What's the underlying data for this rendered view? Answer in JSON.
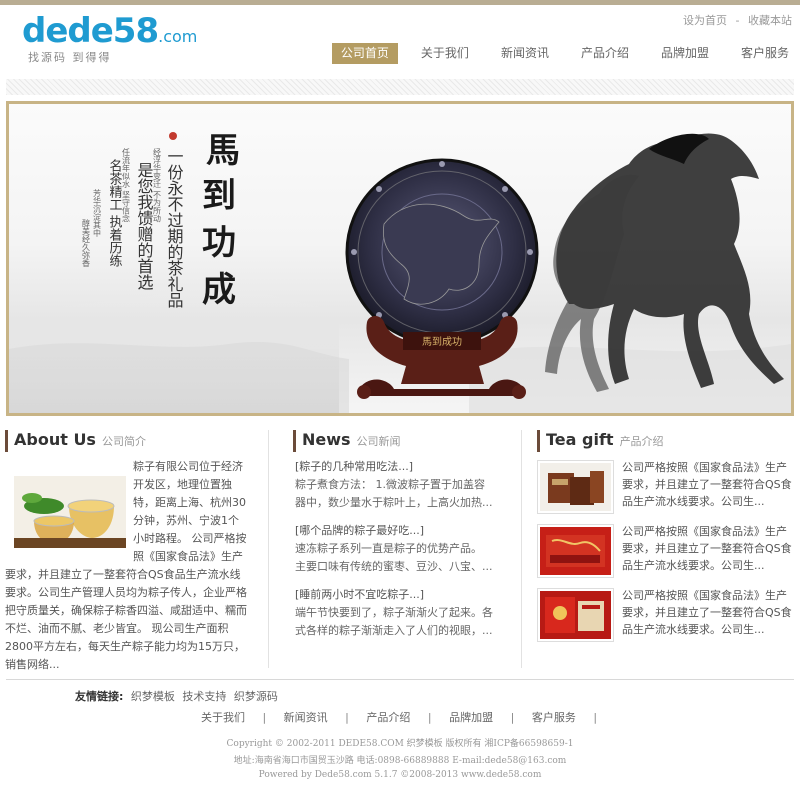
{
  "brand": {
    "logo_text": "dede",
    "logo_num": "58",
    "logo_com": ".com",
    "slogan": "找源码 到得得"
  },
  "toplinks": {
    "home": "设为首页",
    "fav": "收藏本站",
    "sep": "-"
  },
  "nav": [
    {
      "label": "公司首页",
      "active": true
    },
    {
      "label": "关于我们"
    },
    {
      "label": "新闻资讯"
    },
    {
      "label": "产品介绍"
    },
    {
      "label": "品牌加盟"
    },
    {
      "label": "客户服务"
    }
  ],
  "banner": {
    "title_chars": [
      "馬",
      "到",
      "功",
      "成"
    ],
    "line1": "一份永不过期的茶礼品",
    "line2": "是您我馈赠的首选",
    "line3": "名茶精工 执着历练",
    "small1": "经浮华变迁 不为所动",
    "small2": "任流年似水 坚守信念",
    "small3": "芳华沉淀其中",
    "small4": "醇美经久弥香",
    "plaque": "馬到成功"
  },
  "about": {
    "title": "About Us",
    "sub": "公司简介",
    "text": "粽子有限公司位于经济开发区，地理位置独特，距离上海、杭州30分钟，苏州、宁波1个小时路程。 公司严格按照《国家食品法》生产要求，并且建立了一整套符合QS食品生产流水线要求。公司生产管理人员均为粽子传人，企业严格把守质量关，确保粽子粽香四溢、咸甜适中、糯而不烂、油而不腻、老少皆宜。 现公司生产面积2800平方左右，每天生产粽子能力均为15万只，销售网络..."
  },
  "news": {
    "title": "News",
    "sub": "公司新闻",
    "items": [
      {
        "title": "[粽子的几种常用吃法...]",
        "desc": "粽子煮食方法： 1.微波粽子置于加盖容器中，数少量水于粽叶上，上高火加热..."
      },
      {
        "title": "[哪个品牌的粽子最好吃...]",
        "desc": "速冻粽子系列一直是粽子的优势产品。 主要口味有传统的蜜枣、豆沙、八宝、..."
      },
      {
        "title": "[睡前两小时不宜吃粽子...]",
        "desc": "端午节快要到了，粽子渐渐火了起来。各式各样的粽子渐渐走入了人们的视眼，..."
      }
    ]
  },
  "tea": {
    "title": "Tea gift",
    "sub": "产品介绍",
    "items": [
      {
        "desc": "公司严格按照《国家食品法》生产要求，并且建立了一整套符合QS食品生产流水线要求。公司生..."
      },
      {
        "desc": "公司严格按照《国家食品法》生产要求，并且建立了一整套符合QS食品生产流水线要求。公司生..."
      },
      {
        "desc": "公司严格按照《国家食品法》生产要求，并且建立了一整套符合QS食品生产流水线要求。公司生..."
      }
    ]
  },
  "friends": {
    "label": "友情链接:",
    "links": [
      "织梦模板",
      "技术支持",
      "织梦源码"
    ]
  },
  "footnav": {
    "items": [
      "关于我们",
      "新闻资讯",
      "产品介绍",
      "品牌加盟",
      "客户服务"
    ],
    "sep": "|"
  },
  "copyright": {
    "line1": "Copyright © 2002-2011 DEDE58.COM 织梦模板 版权所有 湘ICP备66598659-1",
    "line2": "地址:海南省海口市国贸玉沙路 电话:0898-66889888 E-mail:dede58@163.com",
    "line3": "Powered by Dede58.com 5.1.7 ©2008-2013 www.dede58.com"
  },
  "colors": {
    "accent": "#b49c62",
    "logo_blue": "#1f9bd1",
    "border": "#c8b486"
  }
}
